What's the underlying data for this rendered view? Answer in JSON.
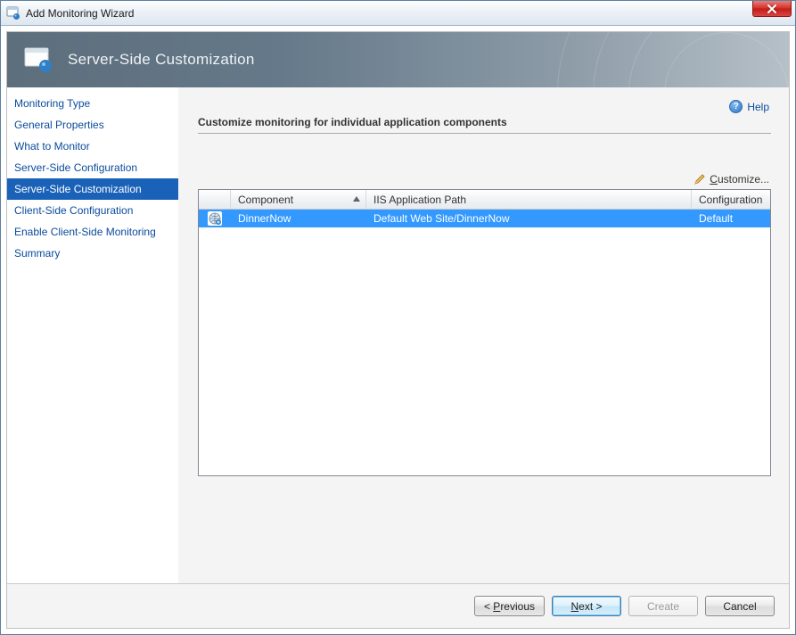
{
  "window": {
    "title": "Add Monitoring Wizard"
  },
  "banner": {
    "title": "Server-Side Customization"
  },
  "sidebar": {
    "items": [
      {
        "label": "Monitoring Type",
        "selected": false
      },
      {
        "label": "General Properties",
        "selected": false
      },
      {
        "label": "What to Monitor",
        "selected": false
      },
      {
        "label": "Server-Side Configuration",
        "selected": false
      },
      {
        "label": "Server-Side Customization",
        "selected": true
      },
      {
        "label": "Client-Side Configuration",
        "selected": false
      },
      {
        "label": "Enable Client-Side Monitoring",
        "selected": false
      },
      {
        "label": "Summary",
        "selected": false
      }
    ]
  },
  "content": {
    "help_label": "Help",
    "section_header": "Customize monitoring for individual application components",
    "customize_label": "Customize...",
    "columns": {
      "component": "Component",
      "path": "IIS Application Path",
      "config": "Configuration"
    },
    "rows": [
      {
        "component": "DinnerNow",
        "path": "Default Web Site/DinnerNow",
        "config": "Default"
      }
    ]
  },
  "buttons": {
    "previous": "Previous",
    "next": "Next >",
    "create": "Create",
    "cancel": "Cancel"
  }
}
